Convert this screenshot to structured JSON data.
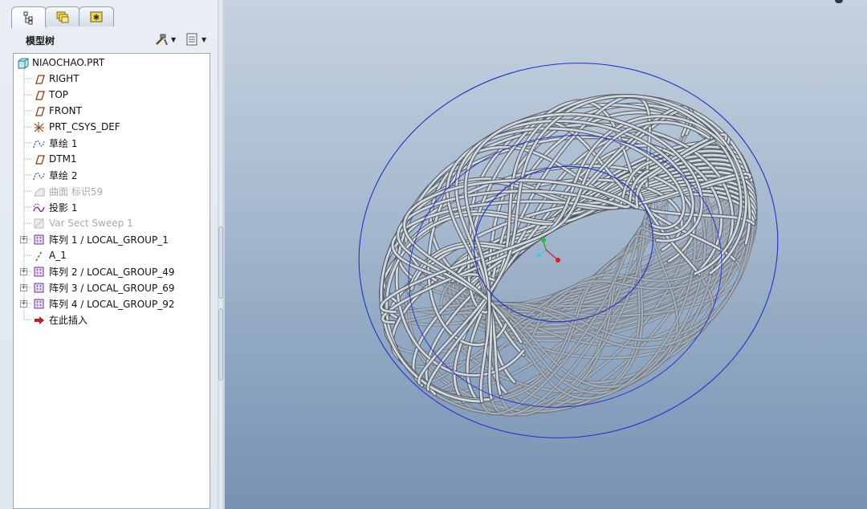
{
  "panel": {
    "title": "模型树",
    "tabs": [
      {
        "name": "model-tree-tab",
        "icon": "tree-icon"
      },
      {
        "name": "folder-browser-tab",
        "icon": "folders-icon"
      },
      {
        "name": "favorites-tab",
        "icon": "favorites-icon"
      }
    ]
  },
  "tree": {
    "root": "NIAOCHAO.PRT",
    "items": [
      {
        "label": "RIGHT",
        "icon": "datum-plane-icon",
        "dim": false,
        "expandable": false
      },
      {
        "label": "TOP",
        "icon": "datum-plane-icon",
        "dim": false,
        "expandable": false
      },
      {
        "label": "FRONT",
        "icon": "datum-plane-icon",
        "dim": false,
        "expandable": false
      },
      {
        "label": "PRT_CSYS_DEF",
        "icon": "coordinate-system-icon",
        "dim": false,
        "expandable": false
      },
      {
        "label": "草绘 1",
        "icon": "sketch-icon",
        "dim": false,
        "expandable": false
      },
      {
        "label": "DTM1",
        "icon": "datum-plane-icon",
        "dim": false,
        "expandable": false
      },
      {
        "label": "草绘 2",
        "icon": "sketch-icon",
        "dim": false,
        "expandable": false
      },
      {
        "label": "曲面 标识59",
        "icon": "surface-icon",
        "dim": true,
        "expandable": false
      },
      {
        "label": "投影 1",
        "icon": "projection-icon",
        "dim": false,
        "expandable": false
      },
      {
        "label": "Var Sect Sweep 1",
        "icon": "sweep-icon",
        "dim": true,
        "expandable": false
      },
      {
        "label": "阵列 1 / LOCAL_GROUP_1",
        "icon": "pattern-icon",
        "dim": false,
        "expandable": true
      },
      {
        "label": "A_1",
        "icon": "datum-axis-icon",
        "dim": false,
        "expandable": false
      },
      {
        "label": "阵列 2 / LOCAL_GROUP_49",
        "icon": "pattern-icon",
        "dim": false,
        "expandable": true
      },
      {
        "label": "阵列 3 / LOCAL_GROUP_69",
        "icon": "pattern-icon",
        "dim": false,
        "expandable": true
      },
      {
        "label": "阵列 4 / LOCAL_GROUP_92",
        "icon": "pattern-icon",
        "dim": false,
        "expandable": true
      },
      {
        "label": "在此插入",
        "icon": "insert-here-arrow-icon",
        "dim": false,
        "expandable": false
      }
    ]
  },
  "viewport": {
    "model": "torus-lattice-model",
    "colors": {
      "struts": "#d4d9df",
      "strut_shadow": "#4f5760",
      "edges": "#1f2fd0",
      "background_top": "#c6d2e0",
      "background_bottom": "#7691b2"
    }
  }
}
